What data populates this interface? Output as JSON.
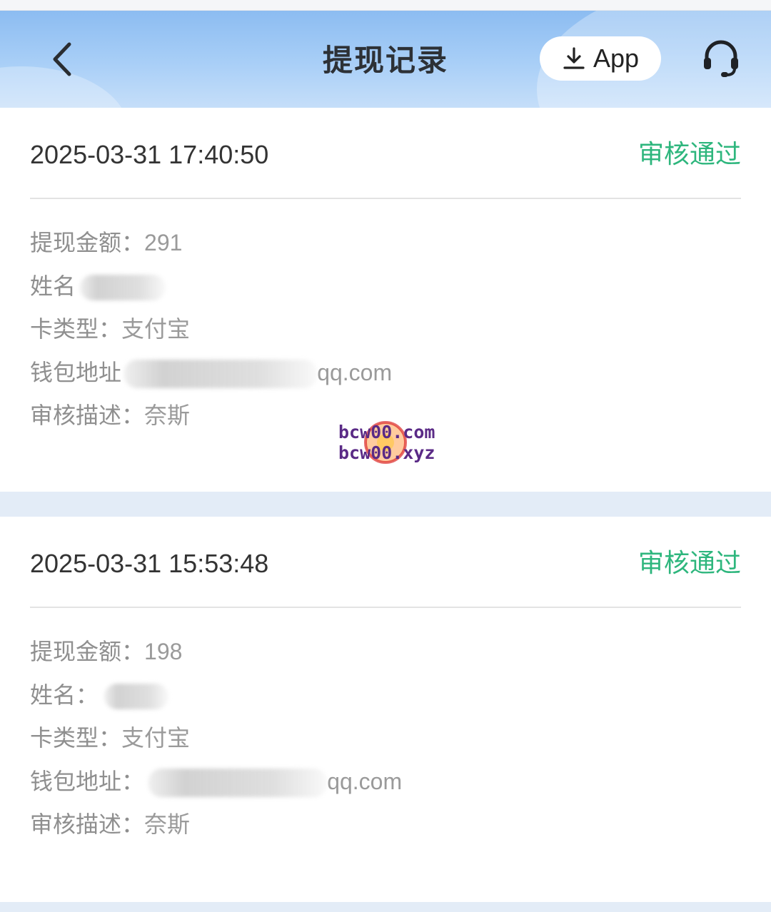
{
  "header": {
    "title": "提现记录",
    "app_button_label": "App",
    "colors": {
      "header_top": "#8cbcf1",
      "header_bottom": "#c5def9",
      "status_green": "#2eb67d"
    }
  },
  "records": [
    {
      "time": "2025-03-31 17:40:50",
      "status": "审核通过",
      "amount_label": "提现金额：",
      "amount": "291",
      "name_label": "姓名",
      "card_type_label": "卡类型：",
      "card_type": "支付宝",
      "wallet_label": "钱包地址",
      "wallet_visible_suffix": "qq.com",
      "desc_label": "审核描述：",
      "desc": "奈斯"
    },
    {
      "time": "2025-03-31 15:53:48",
      "status": "审核通过",
      "amount_label": "提现金额：",
      "amount": "198",
      "name_label": "姓名：",
      "card_type_label": "卡类型：",
      "card_type": "支付宝",
      "wallet_label": "钱包地址：",
      "wallet_visible_suffix": "qq.com",
      "desc_label": "审核描述：",
      "desc": "奈斯"
    }
  ],
  "watermark": {
    "line1": "bcw00.com",
    "line2": "bcw00.xyz"
  },
  "icons": {
    "back": "chevron-left-icon",
    "download": "download-icon",
    "support": "headset-icon"
  }
}
